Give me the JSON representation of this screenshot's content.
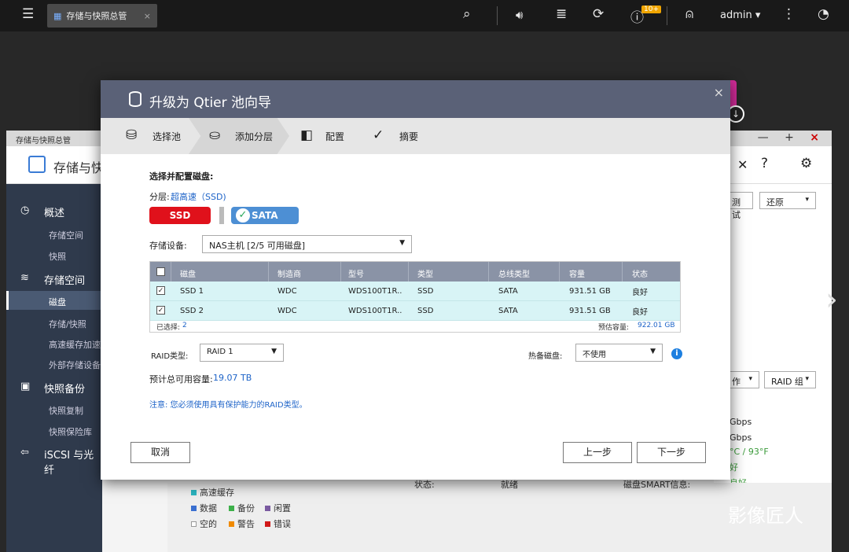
{
  "topbar": {
    "tab_label": "存储与快照总管",
    "tab_close": "×",
    "notification_count": "10+",
    "user": "admin ▾"
  },
  "bg": {
    "title": "存储与快照总管",
    "header": "存储与快",
    "controls": "— + ×",
    "sidebar": [
      {
        "label": "概述",
        "type": "group"
      },
      {
        "label": "存储空间",
        "type": "item"
      },
      {
        "label": "快照",
        "type": "item"
      },
      {
        "label": "存储空间",
        "type": "group"
      },
      {
        "label": "磁盘",
        "type": "item"
      },
      {
        "label": "存储/快照",
        "type": "item"
      },
      {
        "label": "高速缓存加速",
        "type": "item"
      },
      {
        "label": "外部存储设备",
        "type": "item"
      },
      {
        "label": "快照备份",
        "type": "group"
      },
      {
        "label": "快照复制",
        "type": "item"
      },
      {
        "label": "快照保险库",
        "type": "item"
      },
      {
        "label": "iSCSI 与光纤",
        "type": "group"
      }
    ],
    "right_btn1": "测试",
    "right_btn2": "还原",
    "right_btn3": "作",
    "right_btn4": "RAID 组",
    "right_l1": "Gbps",
    "right_l2": "Gbps",
    "right_l3": "°C / 93°F",
    "right_l4": "好",
    "right_l5": "良好",
    "legend": {
      "cache": "高速缓存",
      "data": "数据",
      "backup": "备份",
      "idle": "闲置",
      "empty": "空的",
      "warn": "警告",
      "error": "错误"
    },
    "status_label": "状态:",
    "status_value": "就绪",
    "smart_label": "磁盘SMART信息:"
  },
  "dialog": {
    "title": "升级为 Qtier 池向导",
    "close": "×",
    "steps": [
      "选择池",
      "添加分层",
      "配置",
      "摘要"
    ],
    "section_title": "选择并配置磁盘:",
    "tier_label": "分层:",
    "tier_value": "超高速（SSD)",
    "tier_ssd": "SSD",
    "tier_sata": "SATA",
    "storage_label": "存储设备:",
    "storage_value": "NAS主机 [2/5 可用磁盘]",
    "table": {
      "headers": [
        "磁盘",
        "制造商",
        "型号",
        "类型",
        "总线类型",
        "容量",
        "状态"
      ],
      "rows": [
        [
          "SSD 1",
          "WDC",
          "WDS100T1R..",
          "SSD",
          "SATA",
          "931.51 GB",
          "良好"
        ],
        [
          "SSD 2",
          "WDC",
          "WDS100T1R..",
          "SSD",
          "SATA",
          "931.51 GB",
          "良好"
        ]
      ],
      "selected_label": "已选择:",
      "selected_count": "2",
      "est_label": "预估容量:",
      "est_value": "922.01 GB"
    },
    "raid_label": "RAID类型:",
    "raid_value": "RAID 1",
    "spare_label": "热备磁盘:",
    "spare_value": "不使用",
    "capacity_label": "预计总可用容量:",
    "capacity_value": "19.07 TB",
    "note": "注意: 您必须使用具有保护能力的RAID类型。",
    "cancel": "取消",
    "prev": "上一步",
    "next": "下一步"
  },
  "watermark": "影像匠人"
}
